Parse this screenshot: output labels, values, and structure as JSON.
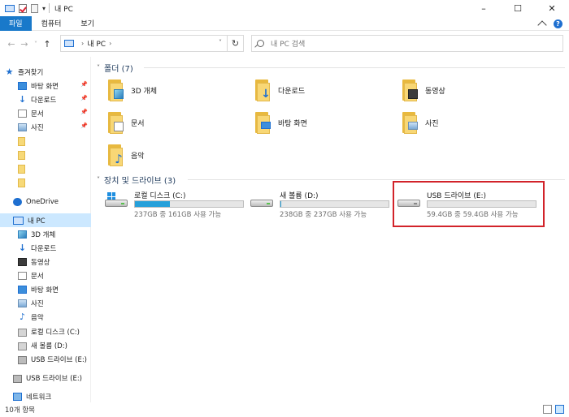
{
  "window": {
    "title": "내 PC",
    "title_icons": [
      "computer-icon",
      "properties-icon",
      "new-folder-icon",
      "customize-dropdown-icon"
    ],
    "controls": {
      "minimize": "–",
      "maximize": "☐",
      "close": "✕"
    }
  },
  "ribbon": {
    "tabs": [
      {
        "label": "파일",
        "active": true
      },
      {
        "label": "컴퓨터"
      },
      {
        "label": "보기"
      }
    ],
    "help": "?"
  },
  "address": {
    "back": "←",
    "forward": "→",
    "recent": "˅",
    "up": "↑",
    "path": [
      "내 PC"
    ],
    "refresh": "↻",
    "search_placeholder": "내 PC 검색"
  },
  "sidebar": {
    "quick_access": {
      "label": "즐겨찾기",
      "items": [
        {
          "label": "바탕 화면",
          "icon": "desktop-icon",
          "pinned": true
        },
        {
          "label": "다운로드",
          "icon": "download-icon",
          "pinned": true
        },
        {
          "label": "문서",
          "icon": "documents-icon",
          "pinned": true
        },
        {
          "label": "사진",
          "icon": "pictures-icon",
          "pinned": true
        },
        {
          "label": "",
          "icon": "folder-icon"
        },
        {
          "label": "",
          "icon": "folder-icon"
        },
        {
          "label": "",
          "icon": "folder-icon"
        },
        {
          "label": "",
          "icon": "folder-icon"
        }
      ]
    },
    "onedrive": "OneDrive",
    "this_pc": {
      "label": "내 PC",
      "items": [
        {
          "label": "3D 개체",
          "icon": "3d-objects-icon"
        },
        {
          "label": "다운로드",
          "icon": "download-icon"
        },
        {
          "label": "동영상",
          "icon": "videos-icon"
        },
        {
          "label": "문서",
          "icon": "documents-icon"
        },
        {
          "label": "바탕 화면",
          "icon": "desktop-icon"
        },
        {
          "label": "사진",
          "icon": "pictures-icon"
        },
        {
          "label": "음악",
          "icon": "music-icon"
        },
        {
          "label": "로컬 디스크 (C:)",
          "icon": "local-disk-icon"
        },
        {
          "label": "새 볼륨 (D:)",
          "icon": "drive-icon"
        },
        {
          "label": "USB 드라이브 (E:)",
          "icon": "usb-drive-icon"
        }
      ]
    },
    "usb_root": "USB 드라이브 (E:)",
    "network": "네트워크"
  },
  "folders_group": {
    "label": "폴더 (7)",
    "items": [
      {
        "label": "3D 개체",
        "icon": "3d-objects-folder-icon"
      },
      {
        "label": "다운로드",
        "icon": "downloads-folder-icon"
      },
      {
        "label": "동영상",
        "icon": "videos-folder-icon"
      },
      {
        "label": "문서",
        "icon": "documents-folder-icon"
      },
      {
        "label": "바탕 화면",
        "icon": "desktop-folder-icon"
      },
      {
        "label": "사진",
        "icon": "pictures-folder-icon"
      },
      {
        "label": "음악",
        "icon": "music-folder-icon"
      }
    ]
  },
  "drives_group": {
    "label": "장치 및 드라이브 (3)",
    "items": [
      {
        "name": "로컬 디스크 (C:)",
        "info": "237GB 중 161GB 사용 가능",
        "used_fraction": 0.32,
        "icon": "local-disk-icon"
      },
      {
        "name": "새 볼륨 (D:)",
        "info": "238GB 중 237GB 사용 가능",
        "used_fraction": 0.004,
        "icon": "drive-icon"
      },
      {
        "name": "USB 드라이브 (E:)",
        "info": "59.4GB 중 59.4GB 사용 가능",
        "used_fraction": 0.0,
        "icon": "usb-drive-icon",
        "highlighted": true
      }
    ]
  },
  "status": {
    "item_count": "10개 항목"
  },
  "colors": {
    "accent": "#1979ca",
    "drive_fill": "#26a0da",
    "highlight": "#d2232a",
    "selection": "#cce8ff"
  }
}
